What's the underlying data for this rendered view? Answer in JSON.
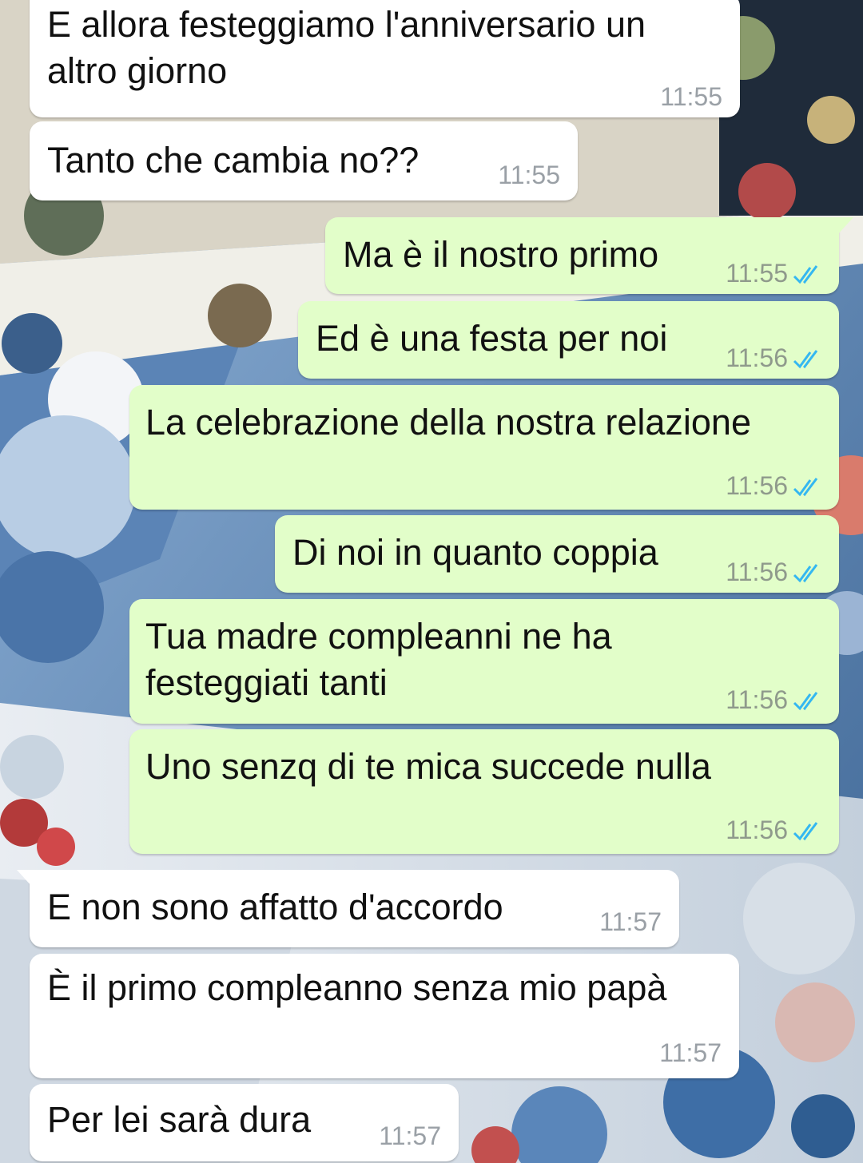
{
  "colors": {
    "incoming_bubble": "#ffffff",
    "outgoing_bubble": "#e2fec9",
    "timestamp": "#8f9a8c",
    "read_ticks": "#34b7f1"
  },
  "messages": [
    {
      "direction": "in",
      "text_lines": [
        "E allora festeggiamo l'anniversario un",
        "altro giorno"
      ],
      "time": "11:55"
    },
    {
      "direction": "in",
      "text_lines": [
        "Tanto che cambia no??"
      ],
      "time": "11:55"
    },
    {
      "direction": "out",
      "text_lines": [
        "Ma è il nostro primo"
      ],
      "time": "11:55",
      "status_icon": "double-check-read-icon"
    },
    {
      "direction": "out",
      "text_lines": [
        "Ed è una festa per noi"
      ],
      "time": "11:56",
      "status_icon": "double-check-read-icon"
    },
    {
      "direction": "out",
      "text_lines": [
        "La celebrazione della nostra relazione"
      ],
      "time": "11:56",
      "status_icon": "double-check-read-icon"
    },
    {
      "direction": "out",
      "text_lines": [
        "Di noi in quanto coppia"
      ],
      "time": "11:56",
      "status_icon": "double-check-read-icon"
    },
    {
      "direction": "out",
      "text_lines": [
        "Tua madre compleanni ne ha",
        "festeggiati tanti"
      ],
      "time": "11:56",
      "status_icon": "double-check-read-icon"
    },
    {
      "direction": "out",
      "text_lines": [
        "Uno senzq di te mica succede nulla"
      ],
      "time": "11:56",
      "status_icon": "double-check-read-icon"
    },
    {
      "direction": "in",
      "text_lines": [
        "E non sono affatto d'accordo"
      ],
      "time": "11:57"
    },
    {
      "direction": "in",
      "text_lines": [
        "È il primo compleanno senza mio papà"
      ],
      "time": "11:57"
    },
    {
      "direction": "in",
      "text_lines": [
        "Per lei sarà dura"
      ],
      "time": "11:57"
    }
  ]
}
